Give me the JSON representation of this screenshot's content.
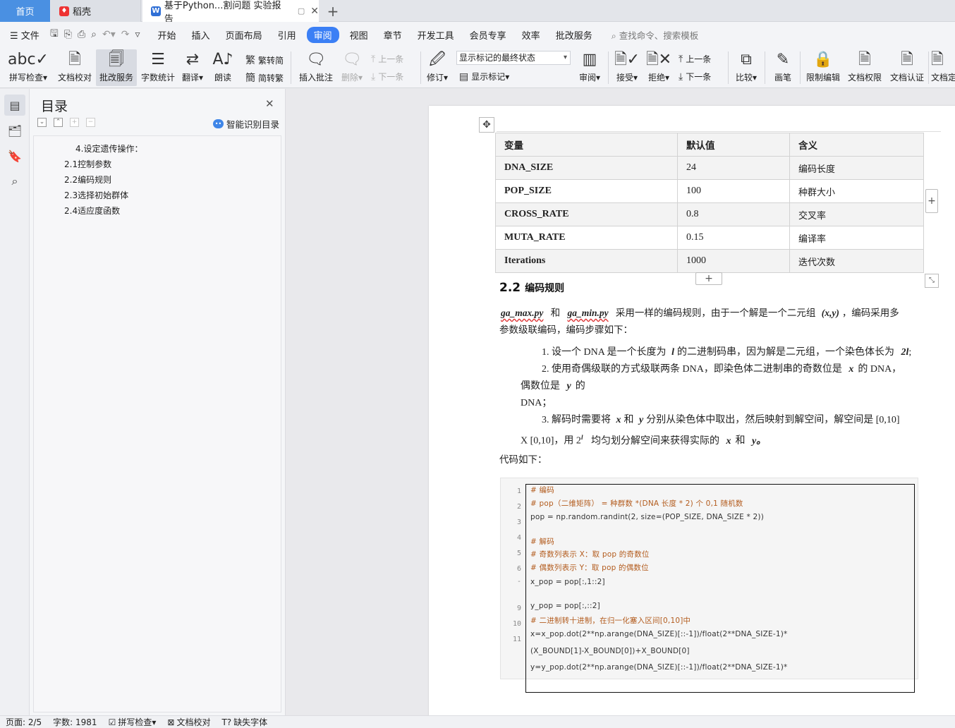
{
  "tabs": {
    "home": "首页",
    "docer": "稻壳",
    "active_doc": "基于Python...割问题 实验报告"
  },
  "menu": {
    "file": "文件",
    "items": [
      "开始",
      "插入",
      "页面布局",
      "引用",
      "审阅",
      "视图",
      "章节",
      "开发工具",
      "会员专享",
      "效率",
      "批改服务"
    ],
    "active_index": 4,
    "search": "查找命令、搜索模板"
  },
  "ribbon": {
    "spell": "拼写检查",
    "proofread": "文档校对",
    "review_service": "批改服务",
    "word_count": "字数统计",
    "translate": "翻译",
    "read_aloud": "朗读",
    "trad": "繁转简",
    "simp": "简转繁",
    "insert_comment": "插入批注",
    "delete": "删除",
    "prev_item": "上一条",
    "next_item": "下一条",
    "revise": "修订",
    "markup_state": "显示标记的最终状态",
    "show_markup": "显示标记",
    "review": "审阅",
    "accept": "接受",
    "reject": "拒绝",
    "prev_change": "上一条",
    "next_change": "下一条",
    "compare": "比较",
    "pen": "画笔",
    "restrict": "限制编辑",
    "permission": "文档权限",
    "certify": "文档认证",
    "more": "文档定"
  },
  "toc": {
    "title": "目录",
    "smart": "智能识别目录",
    "items": [
      "4.设定遗传操作：",
      "2.1控制参数",
      "2.2编码规则",
      "2.3选择初始群体",
      "2.4适应度函数"
    ]
  },
  "document": {
    "table": {
      "headers": [
        "变量",
        "默认值",
        "含义"
      ],
      "rows": [
        [
          "DNA_SIZE",
          "24",
          "编码长度"
        ],
        [
          "POP_SIZE",
          "100",
          "种群大小"
        ],
        [
          "CROSS_RATE",
          "0.8",
          "交叉率"
        ],
        [
          "MUTA_RATE",
          "0.15",
          "编译率"
        ],
        [
          "Iterations",
          "1000",
          "迭代次数"
        ]
      ]
    },
    "section_num": "2.2",
    "section_title": "编码规则",
    "p1_a": "ga_max.py",
    "p1_b": "和",
    "p1_c": "ga_min.py",
    "p1_d": "采用一样的编码规则，由于一个解是一个二元组",
    "p1_e": "(x,y)",
    "p1_f": "，编码采用多",
    "p1_line2": "参数级联编码，编码步骤如下：",
    "step1": "1.  设一个 DNA 是一个长度为",
    "step1_l": "l",
    "step1_b": "的二进制码串，因为解是二元组，一个染色体长为",
    "step1_2l": "2l",
    "step1_end": ";",
    "step2": "2.  使用奇偶级联的方式级联两条 DNA，即染色体二进制串的奇数位是",
    "step2_x": "x",
    "step2_b": "的 DNA，",
    "step2_line2": "偶数位是",
    "step2_y": "y",
    "step2_c": "的",
    "step2_line3": "DNA；",
    "step3": "3.  解码时需要将",
    "step3_x": "x",
    "step3_and": "和",
    "step3_y": "y",
    "step3_b": "分别从染色体中取出，然后映射到解空间，解空间是 [0,10]",
    "step3_line2a": "X [0,10]，用 2",
    "step3_sup": "l",
    "step3_line2b": "均匀划分解空间来获得实际的",
    "step3_x2": "x",
    "step3_and2": "和",
    "step3_y2": "y。",
    "code_intro": "代码如下：",
    "line_numbers": [
      "1",
      "2",
      "3",
      "4",
      "5",
      "6",
      "-",
      "9",
      "10",
      "11"
    ],
    "code": [
      "# 编码",
      "# pop（二维矩阵） = 种群数 *(DNA 长度 * 2) 个 0,1 随机数",
      "pop = np.random.randint(2, size=(POP_SIZE, DNA_SIZE * 2))",
      "# 解码",
      "# 奇数列表示 X：取 pop 的奇数位",
      "# 偶数列表示 Y：取 pop 的偶数位",
      "x_pop = pop[:,1::2]",
      "y_pop = pop[:,::2]",
      "# 二进制转十进制，在归一化塞入区间[0,10]中",
      "x=x_pop.dot(2**np.arange(DNA_SIZE)[::-1])/float(2**DNA_SIZE-1)*",
      "(X_BOUND[1]-X_BOUND[0])+X_BOUND[0]",
      "y=y_pop.dot(2**np.arange(DNA_SIZE)[::-1])/float(2**DNA_SIZE-1)*"
    ]
  },
  "status": {
    "page": "页面: 2/5",
    "words": "字数: 1981",
    "spell": "拼写检查",
    "proof": "文档校对",
    "missing_font": "缺失字体"
  }
}
